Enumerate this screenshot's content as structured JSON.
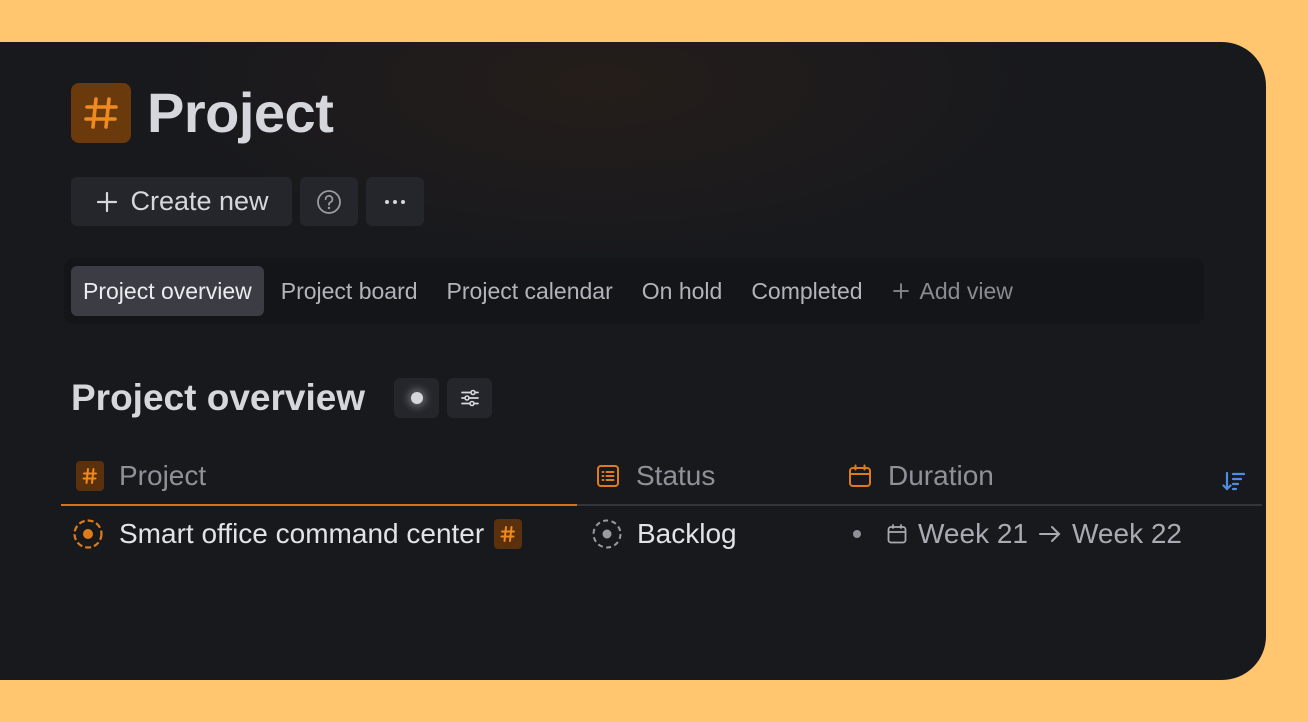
{
  "page": {
    "title": "Project",
    "icon": "hash-icon",
    "accent_color": "#e07b1a"
  },
  "actions": {
    "create_label": "Create new",
    "help_icon": "help-circle-icon",
    "more_icon": "more-horizontal-icon"
  },
  "tabs": [
    {
      "label": "Project overview",
      "active": true
    },
    {
      "label": "Project board",
      "active": false
    },
    {
      "label": "Project calendar",
      "active": false
    },
    {
      "label": "On hold",
      "active": false
    },
    {
      "label": "Completed",
      "active": false
    }
  ],
  "add_view_label": "Add view",
  "section": {
    "title": "Project overview"
  },
  "table": {
    "columns": [
      {
        "label": "Project",
        "icon": "hash-icon"
      },
      {
        "label": "Status",
        "icon": "list-icon"
      },
      {
        "label": "Duration",
        "icon": "calendar-icon"
      }
    ],
    "rows": [
      {
        "project": "Smart office command center",
        "status": "Backlog",
        "duration_start": "Week 21",
        "duration_end": "Week 22"
      }
    ]
  }
}
